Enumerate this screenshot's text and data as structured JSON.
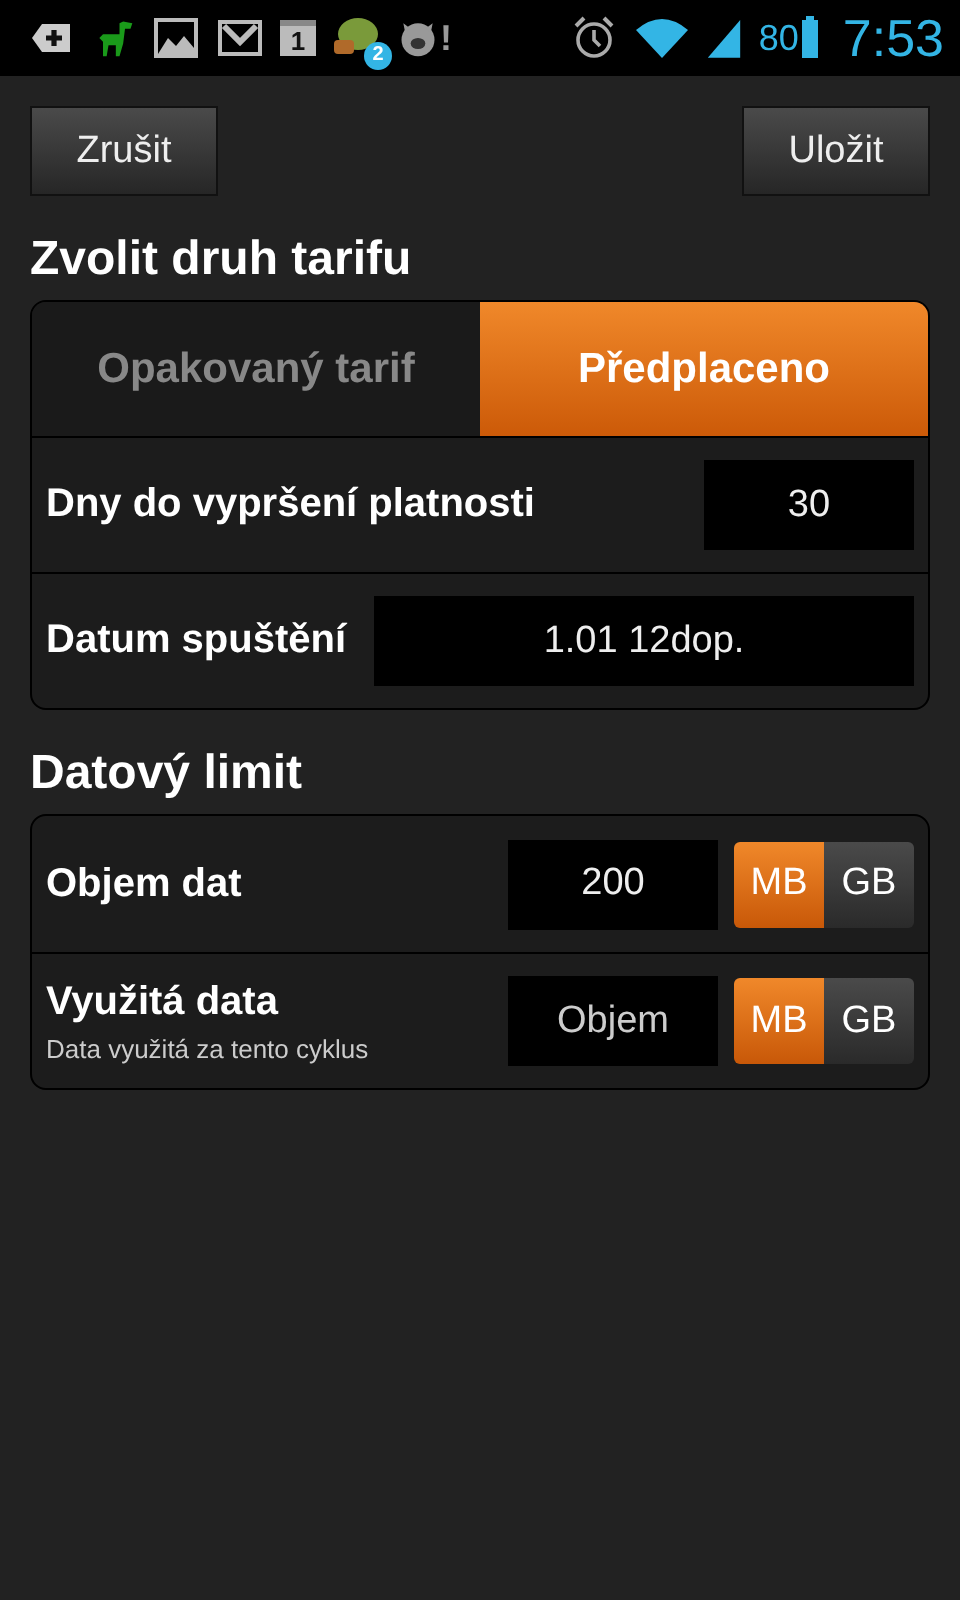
{
  "status_bar": {
    "calendar_day": "1",
    "chat_badge": "2",
    "alert_mark": "!",
    "battery": "80",
    "time": "7:53"
  },
  "buttons": [
    {
      "label": "Zrušit"
    },
    {
      "label": "Uložit"
    }
  ],
  "tariff": {
    "title": "Zvolit druh tarifu",
    "tabs": [
      {
        "label": "Opakovaný tarif",
        "selected": false
      },
      {
        "label": "Předplaceno",
        "selected": true
      }
    ],
    "fields": [
      {
        "label": "Dny do vypršení platnosti",
        "value": "30",
        "kind": "narrow"
      },
      {
        "label": "Datum spuštění",
        "value": "1.01 12dop.",
        "kind": "wide"
      }
    ]
  },
  "data_limit": {
    "title": "Datový limit",
    "rows": [
      {
        "label": "Objem dat",
        "value": "200",
        "units": [
          {
            "label": "MB",
            "selected": true
          },
          {
            "label": "GB",
            "selected": false
          }
        ]
      },
      {
        "label": "Využitá data",
        "sublabel": "Data využitá za tento cyklus",
        "placeholder": "Objem",
        "units": [
          {
            "label": "MB",
            "selected": true
          },
          {
            "label": "GB",
            "selected": false
          }
        ]
      }
    ]
  }
}
